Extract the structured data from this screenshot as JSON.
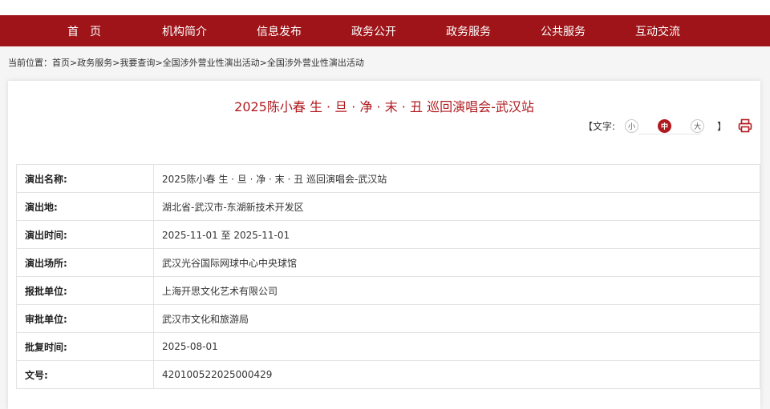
{
  "nav": {
    "items": [
      "首　页",
      "机构简介",
      "信息发布",
      "政务公开",
      "政务服务",
      "公共服务",
      "互动交流"
    ]
  },
  "breadcrumb": {
    "prefix": "当前位置：",
    "items": [
      "首页",
      "政务服务",
      "我要查询",
      "全国涉外营业性演出活动",
      "全国涉外营业性演出活动"
    ],
    "separator": " > "
  },
  "article": {
    "title": "2025陈小春 生 · 旦 · 净 · 末 · 丑 巡回演唱会-武汉站"
  },
  "text_size": {
    "open": "【文字:",
    "small": "小",
    "medium": "中",
    "large": "大",
    "close": "】",
    "selected": "medium"
  },
  "table": {
    "rows": [
      {
        "label": "演出名称:",
        "value": "2025陈小春 生 · 旦 · 净 · 末 · 丑 巡回演唱会-武汉站"
      },
      {
        "label": "演出地:",
        "value": "湖北省-武汉市-东湖新技术开发区"
      },
      {
        "label": "演出时间:",
        "value": "2025-11-01 至 2025-11-01"
      },
      {
        "label": "演出场所:",
        "value": "武汉光谷国际网球中心中央球馆"
      },
      {
        "label": "报批单位:",
        "value": "上海开思文化艺术有限公司"
      },
      {
        "label": "审批单位:",
        "value": "武汉市文化和旅游局"
      },
      {
        "label": "批复时间:",
        "value": "2025-08-01"
      },
      {
        "label": "文号:",
        "value": "420100522025000429"
      }
    ]
  },
  "colors": {
    "brand_red": "#9e1418",
    "title_red": "#b01a1f"
  },
  "icons": {
    "print": "print-icon"
  }
}
